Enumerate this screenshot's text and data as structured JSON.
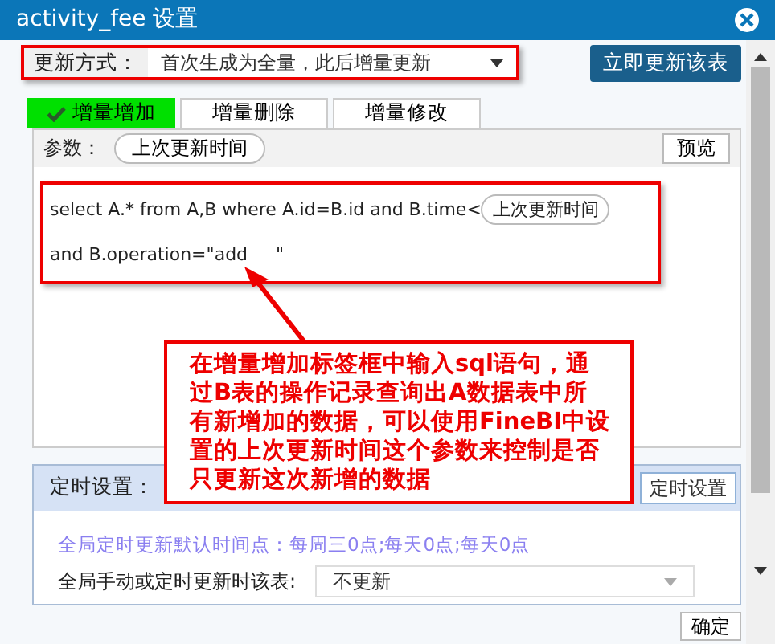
{
  "window": {
    "title": "activity_fee 设置"
  },
  "update_mode": {
    "label": "更新方式：",
    "value": "首次生成为全量，此后增量更新",
    "highlighted": true
  },
  "update_now_button": "立即更新该表",
  "tabs": [
    {
      "label": "增量增加",
      "selected": true
    },
    {
      "label": "增量删除",
      "selected": false
    },
    {
      "label": "增量修改",
      "selected": false
    }
  ],
  "params": {
    "label": "参数：",
    "param_button": "上次更新时间",
    "preview_button": "预览"
  },
  "editor": {
    "line1": "select A.* from A,B where A.id=B.id and B.time<",
    "inline_param": "上次更新时间",
    "line2": "and B.operation=\"add     \"",
    "highlighted": true
  },
  "callout": "在增量增加标签框中输入sql语句，通过B表的操作记录查询出A数据表中所有新增加的数据，可以使用FineBI中设置的上次更新时间这个参数来控制是否只更新这次新增的数据",
  "schedule": {
    "label": "定时设置：",
    "button": "定时设置",
    "default_note": "全局定时更新默认时间点：每周三0点;每天0点;每天0点",
    "row_label": "全局手动或定时更新时该表:",
    "row_value": "不更新"
  },
  "ok_button": "确定"
}
